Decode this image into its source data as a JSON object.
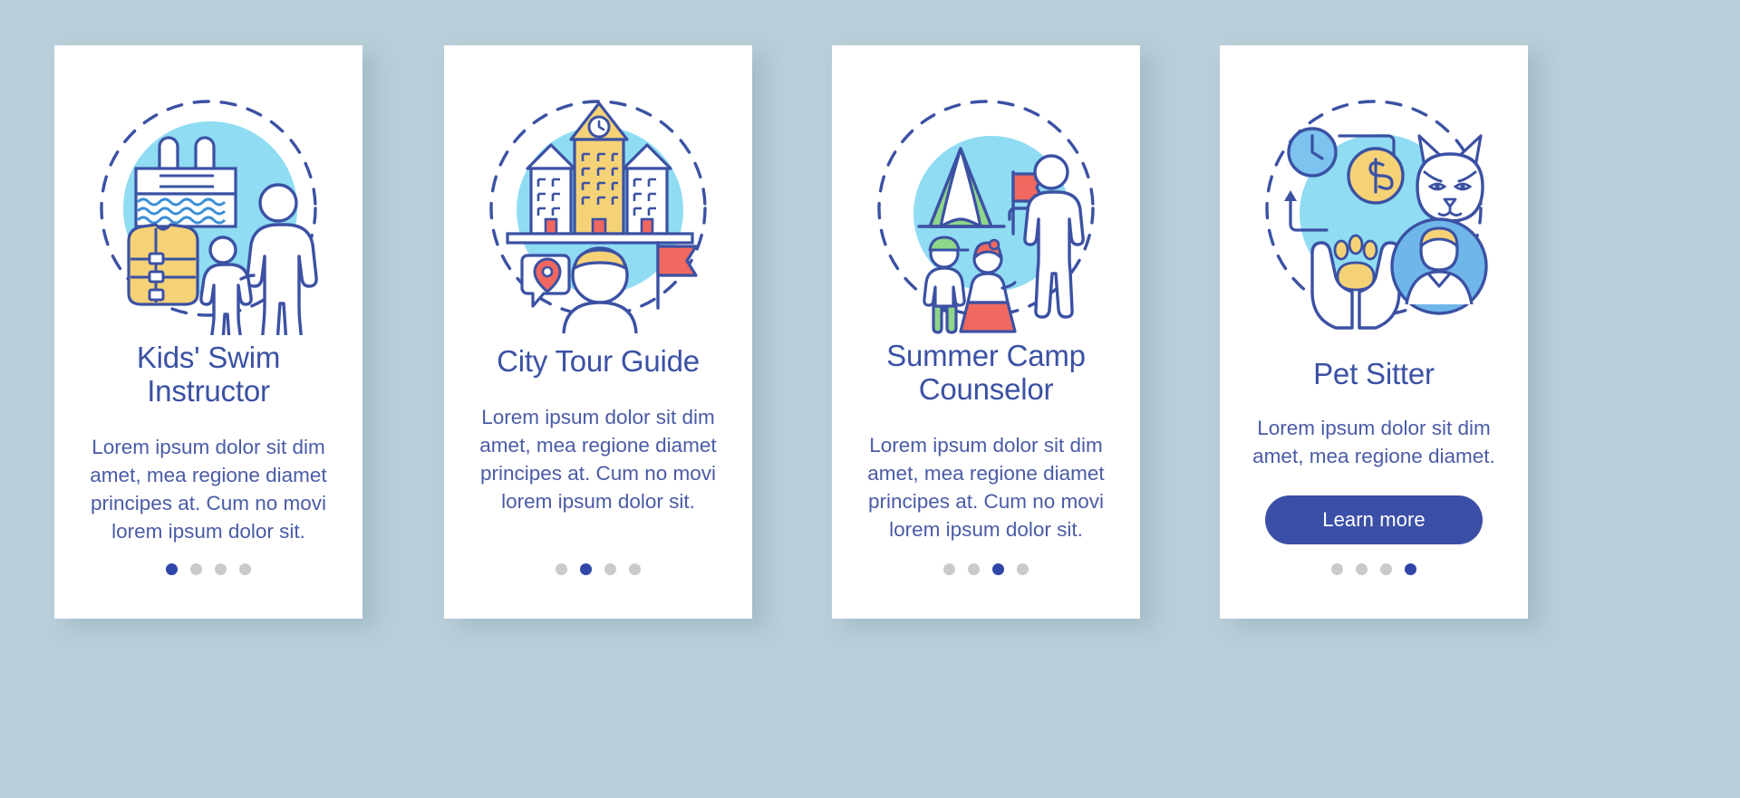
{
  "theme": {
    "background": "#b8ced8",
    "card_background": "#ffffff",
    "title_color": "#3b51a3",
    "body_color": "#4a5ba6",
    "accent_blue": "#2f45a8",
    "dot_inactive": "#c9cacc",
    "illustration_light_blue": "#8fdcf3",
    "illustration_yellow": "#f6d277",
    "illustration_red": "#f0685f",
    "illustration_green": "#8ed68a",
    "illustration_outline": "#3b51a3"
  },
  "cards": [
    {
      "id": "kids-swim-instructor",
      "title": "Kids' Swim Instructor",
      "body": "Lorem ipsum dolor sit dim amet, mea regione diamet principes at. Cum no movi lorem ipsum dolor sit.",
      "illustration_name": "swim-instructor-illustration",
      "dots": {
        "count": 4,
        "active_index": 0
      },
      "has_button": false,
      "button_label": ""
    },
    {
      "id": "city-tour-guide",
      "title": "City Tour Guide",
      "body": "Lorem ipsum dolor sit dim amet, mea regione diamet principes at. Cum no movi lorem ipsum dolor sit.",
      "illustration_name": "city-tour-guide-illustration",
      "dots": {
        "count": 4,
        "active_index": 1
      },
      "has_button": false,
      "button_label": ""
    },
    {
      "id": "summer-camp-counselor",
      "title": "Summer Camp Counselor",
      "body": "Lorem ipsum dolor sit dim amet, mea regione diamet principes at. Cum no movi lorem ipsum dolor sit.",
      "illustration_name": "summer-camp-counselor-illustration",
      "dots": {
        "count": 4,
        "active_index": 2
      },
      "has_button": false,
      "button_label": ""
    },
    {
      "id": "pet-sitter",
      "title": "Pet Sitter",
      "body": "Lorem ipsum dolor sit dim amet, mea regione diamet.",
      "illustration_name": "pet-sitter-illustration",
      "dots": {
        "count": 4,
        "active_index": 3
      },
      "has_button": true,
      "button_label": "Learn more"
    }
  ]
}
